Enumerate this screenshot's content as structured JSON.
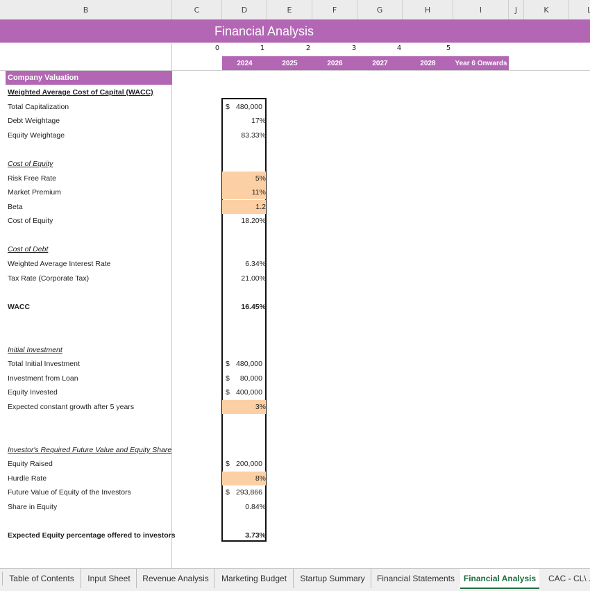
{
  "columns": [
    "B",
    "C",
    "D",
    "E",
    "F",
    "G",
    "H",
    "I",
    "J",
    "K",
    "L"
  ],
  "title": "Financial Analysis",
  "period_index": [
    "0",
    "1",
    "2",
    "3",
    "4",
    "5"
  ],
  "years": [
    "2024",
    "2025",
    "2026",
    "2027",
    "2028",
    "Year 6 Onwards"
  ],
  "section_header": "Company Valuation",
  "rows": [
    {
      "label": "Weighted Average Cost of Capital (WACC)",
      "style": "bold-ul",
      "value": ""
    },
    {
      "label": "Total Capitalization",
      "value": "480,000",
      "currency": "$"
    },
    {
      "label": "Debt Weightage",
      "value": "17%"
    },
    {
      "label": "Equity Weightage",
      "value": "83.33%"
    },
    {
      "label": "Cost of Equity",
      "style": "ital-ul",
      "value": ""
    },
    {
      "label": "Risk Free Rate",
      "value": "5%",
      "input": true
    },
    {
      "label": "Market Premium",
      "value": "11%",
      "input": true
    },
    {
      "label": "Beta",
      "value": "1.2",
      "input": true
    },
    {
      "label": "Cost of Equity",
      "value": "18.20%"
    },
    {
      "label": "Cost of Debt",
      "style": "ital-ul",
      "value": ""
    },
    {
      "label": "Weighted Average Interest Rate",
      "value": "6.34%"
    },
    {
      "label": "Tax Rate (Corporate Tax)",
      "value": "21.00%"
    },
    {
      "label": "WACC",
      "style": "bold",
      "value": "16.45%"
    },
    {
      "label": "Initial Investment",
      "style": "ital-ul",
      "value": ""
    },
    {
      "label": "Total Initial Investment",
      "value": "480,000",
      "currency": "$"
    },
    {
      "label": "Investment from Loan",
      "value": "80,000",
      "currency": "$"
    },
    {
      "label": "Equity Invested",
      "value": "400,000",
      "currency": "$"
    },
    {
      "label": "Expected constant growth after 5 years",
      "value": "3%",
      "input": true
    },
    {
      "label": "Investor's Required Future Value and Equity Share",
      "style": "ital-ul",
      "value": ""
    },
    {
      "label": "Equity Raised",
      "value": "200,000",
      "currency": "$"
    },
    {
      "label": "Hurdle Rate",
      "value": "8%",
      "input": true
    },
    {
      "label": "Future Value of Equity of the Investors",
      "value": "293,866",
      "currency": "$"
    },
    {
      "label": "Share in Equity",
      "value": "0.84%"
    },
    {
      "label": "Expected Equity percentage offered to investors",
      "style": "bold",
      "value": "3.73%"
    }
  ],
  "sheet_tabs": [
    {
      "label": "Table of Contents"
    },
    {
      "label": "Input Sheet"
    },
    {
      "label": "Revenue Analysis"
    },
    {
      "label": "Marketing Budget"
    },
    {
      "label": "Startup Summary"
    },
    {
      "label": "Financial Statements"
    },
    {
      "label": "Financial Analysis",
      "active": true
    },
    {
      "label": "CAC - CL\\ ..."
    }
  ],
  "colors": {
    "accent": "#b366b3",
    "input_highlight": "#fcd0a4",
    "active_tab": "#1e6e3e"
  }
}
